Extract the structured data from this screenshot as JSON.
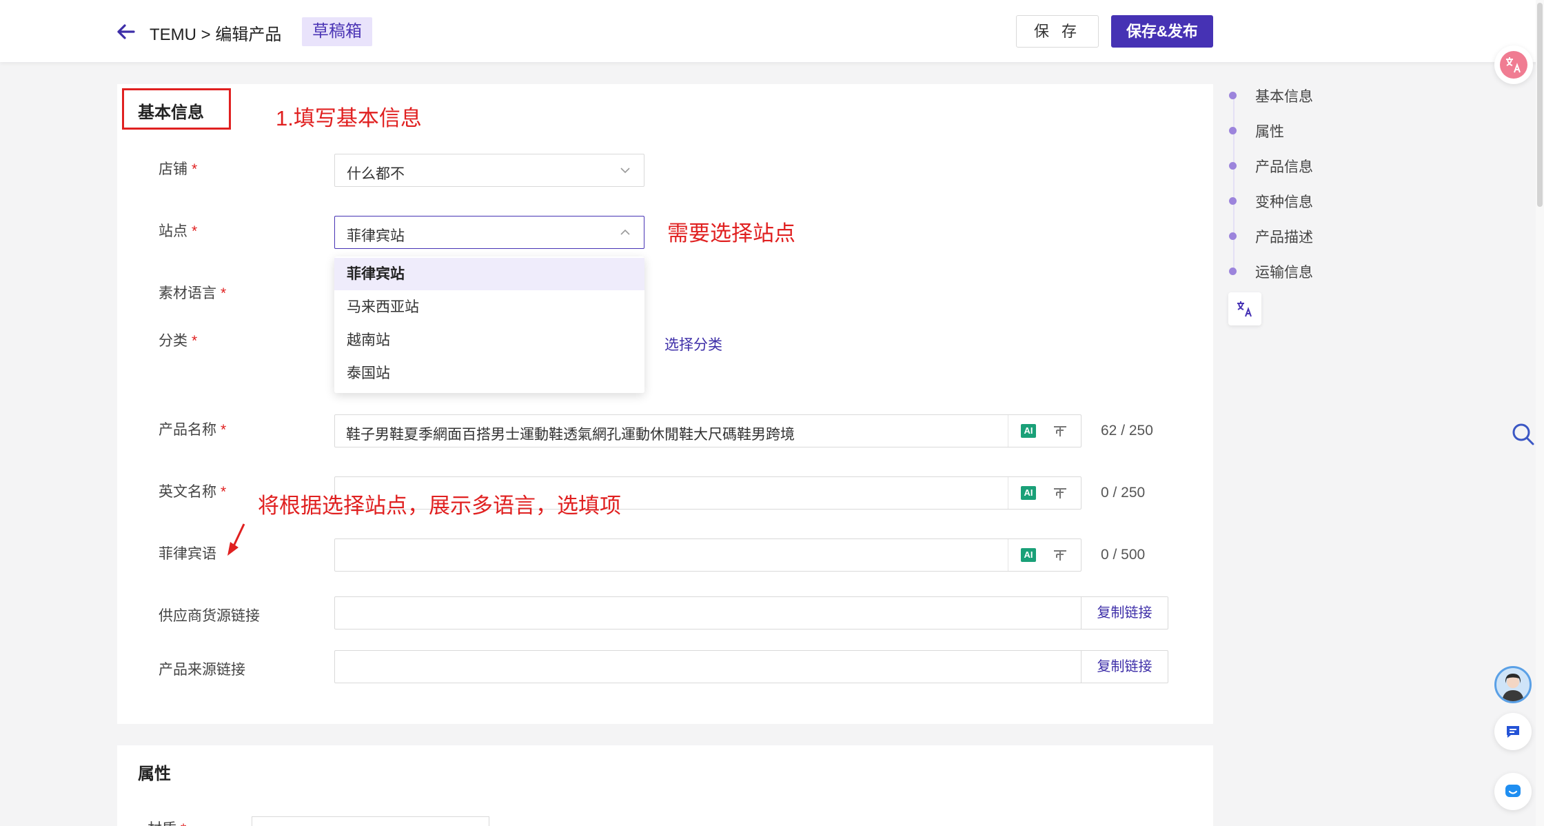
{
  "header": {
    "breadcrumb": "TEMU > 编辑产品",
    "draft_badge": "草稿箱",
    "save_label": "保 存",
    "publish_label": "保存&发布"
  },
  "basic_info": {
    "title": "基本信息",
    "annotation_step": "1.填写基本信息",
    "annotation_site": "需要选择站点",
    "annotation_lang": "将根据选择站点，展示多语言，选填项",
    "required_mark": "*",
    "fields": {
      "shop": {
        "label": "店铺",
        "value": "什么都不"
      },
      "site": {
        "label": "站点",
        "value": "菲律宾站"
      },
      "material_lang": {
        "label": "素材语言"
      },
      "category": {
        "label": "分类",
        "link": "选择分类"
      },
      "product_name": {
        "label": "产品名称",
        "value": "鞋子男鞋夏季網面百搭男士運動鞋透氣網孔運動休閒鞋大尺碼鞋男跨境",
        "counter": "62 / 250"
      },
      "english_name": {
        "label": "英文名称",
        "value": "",
        "counter": "0 / 250"
      },
      "filipino": {
        "label": "菲律宾语",
        "value": "",
        "counter": "0 / 500"
      },
      "supplier_link": {
        "label": "供应商货源链接",
        "copy": "复制链接"
      },
      "source_link": {
        "label": "产品来源链接",
        "copy": "复制链接"
      }
    },
    "site_options": [
      "菲律宾站",
      "马来西亚站",
      "越南站",
      "泰国站"
    ],
    "ai_label": "AI"
  },
  "attributes": {
    "title": "属性",
    "first_label": "材质"
  },
  "side_nav": {
    "items": [
      "基本信息",
      "属性",
      "产品信息",
      "变种信息",
      "产品描述",
      "运输信息"
    ]
  },
  "colors": {
    "accent": "#4632b4",
    "annotation": "#e02020"
  }
}
